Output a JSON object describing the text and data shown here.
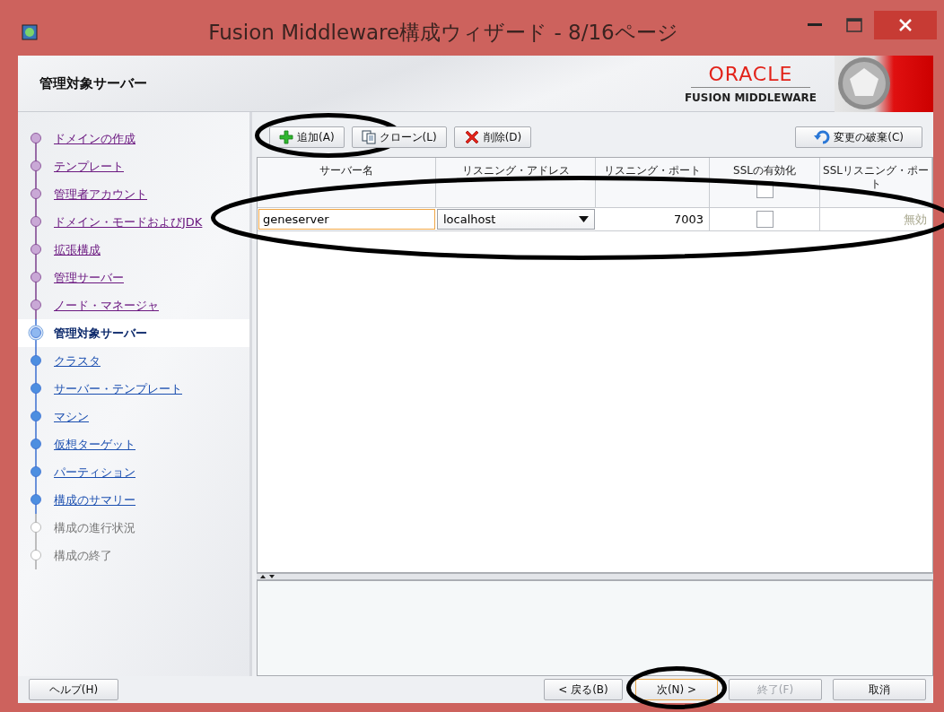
{
  "window": {
    "title": "Fusion Middleware構成ウィザード - 8/16ページ"
  },
  "header": {
    "title": "管理対象サーバー",
    "brand": "ORACLE",
    "product": "FUSION MIDDLEWARE"
  },
  "steps": [
    {
      "label": "ドメインの作成",
      "kind": "visited"
    },
    {
      "label": "テンプレート",
      "kind": "visited"
    },
    {
      "label": "管理者アカウント",
      "kind": "visited"
    },
    {
      "label": "ドメイン・モードおよびJDK",
      "kind": "visited"
    },
    {
      "label": "拡張構成",
      "kind": "visited"
    },
    {
      "label": "管理サーバー",
      "kind": "visited"
    },
    {
      "label": "ノード・マネージャ",
      "kind": "visited"
    },
    {
      "label": "管理対象サーバー",
      "kind": "current"
    },
    {
      "label": "クラスタ",
      "kind": "pending"
    },
    {
      "label": "サーバー・テンプレート",
      "kind": "pending"
    },
    {
      "label": "マシン",
      "kind": "pending"
    },
    {
      "label": "仮想ターゲット",
      "kind": "pending"
    },
    {
      "label": "パーティション",
      "kind": "pending"
    },
    {
      "label": "構成のサマリー",
      "kind": "pending"
    },
    {
      "label": "構成の進行状況",
      "kind": "unavailable"
    },
    {
      "label": "構成の終了",
      "kind": "unavailable"
    }
  ],
  "toolbar": {
    "buttons": [
      {
        "kind": "add",
        "label": "追加(A)",
        "circled": true
      },
      {
        "kind": "clone",
        "label": "クローン(L)",
        "circled": false
      },
      {
        "kind": "delete",
        "label": "削除(D)",
        "circled": false
      }
    ],
    "revert": {
      "label": "変更の破棄(C)"
    }
  },
  "table": {
    "columns": [
      "サーバー名",
      "リスニング・アドレス",
      "リスニング・ポート",
      "SSLの有効化",
      "SSLリスニング・ポート"
    ],
    "ssl_all_checked": false,
    "rows": [
      {
        "server_name": "geneserver",
        "address": "localhost",
        "port": "7003",
        "ssl": false,
        "ssl_port": "無効",
        "circled": true
      }
    ]
  },
  "footer": {
    "help": "ヘルプ(H)",
    "buttons": [
      {
        "label": "< 戻る(B)",
        "disabled": false,
        "default": false,
        "circled": false
      },
      {
        "label": "次(N) >",
        "disabled": false,
        "default": true,
        "circled": true
      },
      {
        "label": "終了(F)",
        "disabled": true,
        "default": false,
        "circled": false
      },
      {
        "label": "取消",
        "disabled": false,
        "default": false,
        "circled": false
      }
    ]
  }
}
